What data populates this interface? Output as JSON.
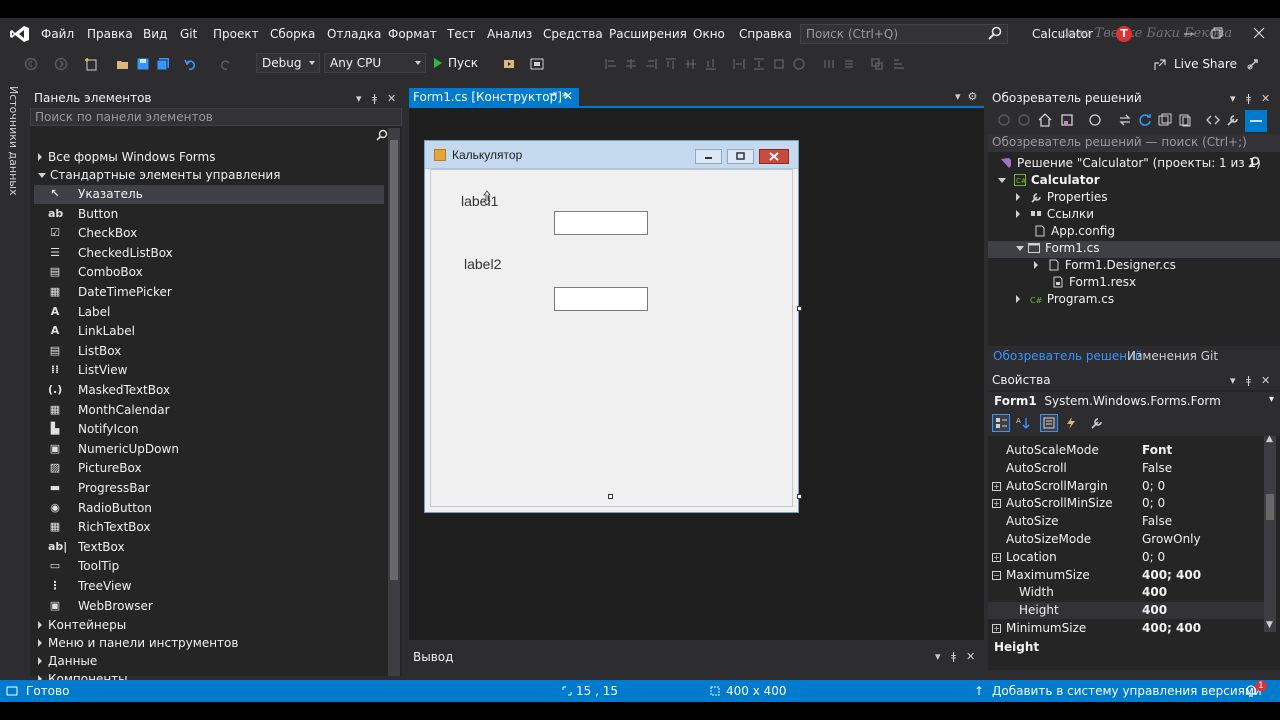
{
  "menu": {
    "items": [
      "Файл",
      "Правка",
      "Вид",
      "Git",
      "Проект",
      "Сборка",
      "Отладка",
      "Формат",
      "Тест",
      "Анализ",
      "Средства",
      "Расширения",
      "Окно",
      "Справка"
    ],
    "search_placeholder": "Поиск (Ctrl+Q)",
    "solution_name": "Calculator",
    "watermark": "сова Тверке Баки Бекова",
    "watermark_badge": "T"
  },
  "toolbar": {
    "config": "Debug",
    "platform": "Any CPU",
    "run_label": "Пуск",
    "live_share": "Live Share"
  },
  "left_tab": "Источники данных",
  "toolbox": {
    "title": "Панель элементов",
    "search_placeholder": "Поиск по панели элементов",
    "category_all": "Все формы Windows Forms",
    "category_common": "Стандартные элементы управления",
    "items": [
      {
        "label": "Указатель",
        "icon": "pointer-icon",
        "glyph": "↖"
      },
      {
        "label": "Button",
        "icon": "button-icon",
        "glyph": "ab"
      },
      {
        "label": "CheckBox",
        "icon": "checkbox-icon",
        "glyph": "☑"
      },
      {
        "label": "CheckedListBox",
        "icon": "checkedlistbox-icon",
        "glyph": "☰"
      },
      {
        "label": "ComboBox",
        "icon": "combobox-icon",
        "glyph": "▤"
      },
      {
        "label": "DateTimePicker",
        "icon": "datetimepicker-icon",
        "glyph": "▦"
      },
      {
        "label": "Label",
        "icon": "label-icon",
        "glyph": "A"
      },
      {
        "label": "LinkLabel",
        "icon": "linklabel-icon",
        "glyph": "A"
      },
      {
        "label": "ListBox",
        "icon": "listbox-icon",
        "glyph": "▤"
      },
      {
        "label": "ListView",
        "icon": "listview-icon",
        "glyph": "⁞⁞"
      },
      {
        "label": "MaskedTextBox",
        "icon": "maskedtextbox-icon",
        "glyph": "(.)"
      },
      {
        "label": "MonthCalendar",
        "icon": "monthcalendar-icon",
        "glyph": "▦"
      },
      {
        "label": "NotifyIcon",
        "icon": "notifyicon-icon",
        "glyph": "▙"
      },
      {
        "label": "NumericUpDown",
        "icon": "numericupdown-icon",
        "glyph": "▣"
      },
      {
        "label": "PictureBox",
        "icon": "picturebox-icon",
        "glyph": "▨"
      },
      {
        "label": "ProgressBar",
        "icon": "progressbar-icon",
        "glyph": "▬"
      },
      {
        "label": "RadioButton",
        "icon": "radiobutton-icon",
        "glyph": "◉"
      },
      {
        "label": "RichTextBox",
        "icon": "richtextbox-icon",
        "glyph": "▦"
      },
      {
        "label": "TextBox",
        "icon": "textbox-icon",
        "glyph": "ab|"
      },
      {
        "label": "ToolTip",
        "icon": "tooltip-icon",
        "glyph": "▭"
      },
      {
        "label": "TreeView",
        "icon": "treeview-icon",
        "glyph": "⋮"
      },
      {
        "label": "WebBrowser",
        "icon": "webbrowser-icon",
        "glyph": "▣"
      }
    ],
    "categories_bottom": [
      "Контейнеры",
      "Меню и панели инструментов",
      "Данные",
      "Компоненты"
    ]
  },
  "document": {
    "tab_label": "Form1.cs [Конструктор]*",
    "form_title": "Калькулятор",
    "label1": "label1",
    "label2": "label2"
  },
  "output": {
    "title": "Вывод"
  },
  "solution_explorer": {
    "title": "Обозреватель решений",
    "search_placeholder": "Обозреватель решений — поиск (Ctrl+;)",
    "nodes": [
      "Решение \"Calculator\" (проекты: 1 из 1)",
      "Calculator",
      "Properties",
      "Ссылки",
      "App.config",
      "Form1.cs",
      "Form1.Designer.cs",
      "Form1.resx",
      "Program.cs"
    ],
    "tab_active": "Обозреватель решений",
    "tab_other": "Изменения Git"
  },
  "properties": {
    "title": "Свойства",
    "object_name": "Form1",
    "object_type": "System.Windows.Forms.Form",
    "rows": [
      {
        "name": "AutoScaleMode",
        "value": "Font"
      },
      {
        "name": "AutoScroll",
        "value": "False"
      },
      {
        "name": "AutoScrollMargin",
        "value": "0; 0"
      },
      {
        "name": "AutoScrollMinSize",
        "value": "0; 0"
      },
      {
        "name": "AutoSize",
        "value": "False"
      },
      {
        "name": "AutoSizeMode",
        "value": "GrowOnly"
      },
      {
        "name": "Location",
        "value": "0; 0"
      },
      {
        "name": "MaximumSize",
        "value": "400; 400"
      },
      {
        "name": "Width",
        "value": "400"
      },
      {
        "name": "Height",
        "value": "400"
      },
      {
        "name": "MinimumSize",
        "value": "400; 400"
      }
    ],
    "description_title": "Height"
  },
  "status": {
    "ready": "Готово",
    "position": "15 , 15",
    "size": "400 x 400",
    "vcs": "Добавить в систему управления версиями",
    "notifications": "1"
  },
  "colors": {
    "accent": "#007acc",
    "background": "#2d2d30",
    "panel": "#252526"
  }
}
